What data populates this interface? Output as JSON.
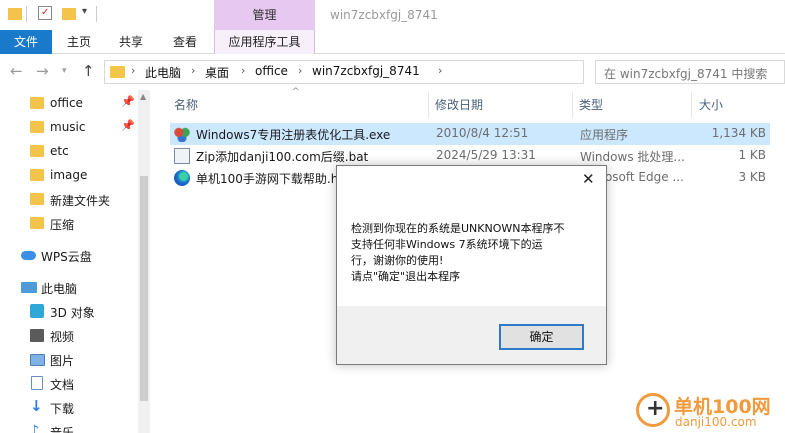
{
  "title_bar": {
    "context_tab": "管理",
    "window_title": "win7zcbxfgj_8741"
  },
  "ribbon": {
    "tabs": [
      "文件",
      "主页",
      "共享",
      "查看",
      "应用程序工具"
    ]
  },
  "address": {
    "crumbs": [
      "此电脑",
      "桌面",
      "office",
      "win7zcbxfgj_8741"
    ],
    "search_placeholder": "在 win7zcbxfgj_8741 中搜索"
  },
  "sidebar": {
    "items": [
      {
        "label": "office",
        "icon": "folder-icon",
        "pinned": true
      },
      {
        "label": "music",
        "icon": "folder-icon",
        "pinned": true
      },
      {
        "label": "etc",
        "icon": "folder-icon",
        "pinned": false
      },
      {
        "label": "image",
        "icon": "folder-icon",
        "pinned": false
      },
      {
        "label": "新建文件夹",
        "icon": "folder-icon",
        "pinned": false
      },
      {
        "label": "压缩",
        "icon": "folder-icon",
        "pinned": false
      },
      {
        "label": "WPS云盘",
        "icon": "cloud-icon",
        "pinned": false
      },
      {
        "label": "此电脑",
        "icon": "pc-icon",
        "pinned": false
      },
      {
        "label": "3D 对象",
        "icon": "cube-icon",
        "pinned": false
      },
      {
        "label": "视频",
        "icon": "video-icon",
        "pinned": false
      },
      {
        "label": "图片",
        "icon": "picture-icon",
        "pinned": false
      },
      {
        "label": "文档",
        "icon": "document-icon",
        "pinned": false
      },
      {
        "label": "下载",
        "icon": "download-icon",
        "pinned": false
      },
      {
        "label": "音乐",
        "icon": "music-icon",
        "pinned": false
      }
    ]
  },
  "file_list": {
    "columns": {
      "name": "名称",
      "date": "修改日期",
      "type": "类型",
      "size": "大小"
    },
    "rows": [
      {
        "name": "Windows7专用注册表优化工具.exe",
        "date": "2010/8/4 12:51",
        "type": "应用程序",
        "size": "1,134 KB",
        "icon": "exe-icon",
        "selected": true
      },
      {
        "name": "Zip添加danji100.com后缀.bat",
        "date": "2024/5/29 13:31",
        "type": "Windows 批处理...",
        "size": "1 KB",
        "icon": "bat-icon",
        "selected": false
      },
      {
        "name": "单机100手游网下载帮助.htm",
        "date": "",
        "type": "Microsoft Edge ...",
        "size": "3 KB",
        "icon": "edge-icon",
        "selected": false
      }
    ]
  },
  "dialog": {
    "lines": [
      "检测到你现在的系统是UNKNOWN本程序不",
      "支持任何非Windows 7系统环境下的运",
      "行，谢谢你的使用!",
      "请点\"确定\"退出本程序"
    ],
    "ok_label": "确定"
  },
  "watermark": {
    "name": "单机100网",
    "url": "danji100.com"
  }
}
